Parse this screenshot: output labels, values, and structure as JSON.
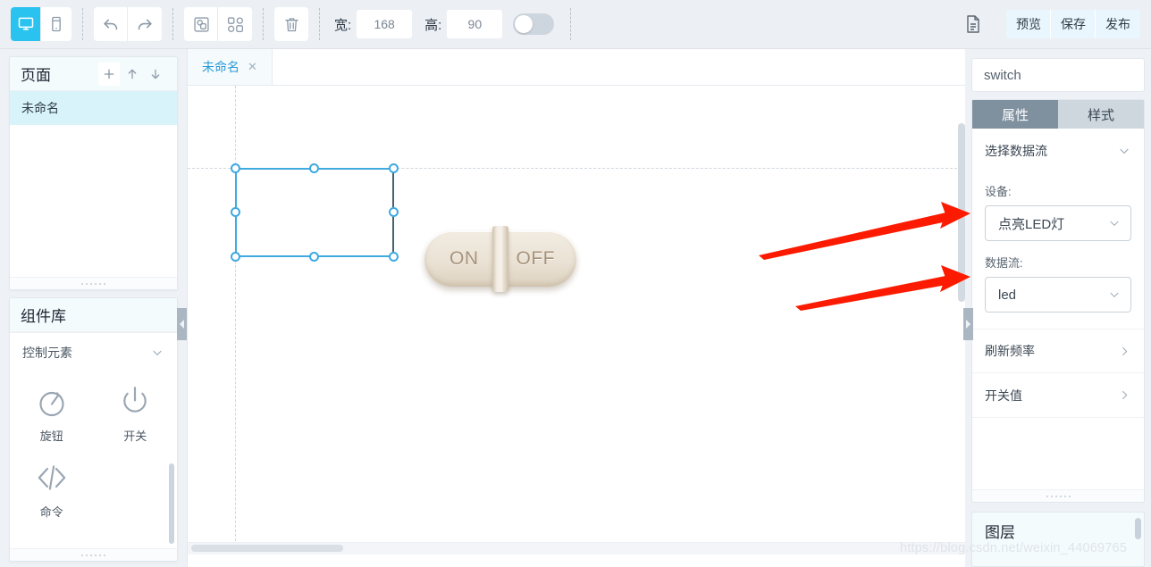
{
  "toolbar": {
    "view_desktop_icon": "desktop-icon",
    "view_mobile_icon": "mobile-icon",
    "undo_icon": "undo-arrow-icon",
    "redo_icon": "redo-arrow-icon",
    "group_icon": "group-icon",
    "ungroup_icon": "ungroup-icon",
    "delete_icon": "trash-icon",
    "width_label": "宽:",
    "width_value": "168",
    "height_label": "高:",
    "height_value": "90",
    "lock_toggle": "off",
    "document_icon": "document-icon",
    "actions": [
      {
        "label": "预览"
      },
      {
        "label": "保存"
      },
      {
        "label": "发布"
      }
    ]
  },
  "pages_panel": {
    "title": "页面",
    "add_icon": "plus-icon",
    "move_up_icon": "arrow-up-icon",
    "move_down_icon": "arrow-down-icon",
    "items": [
      {
        "label": "未命名",
        "selected": true
      }
    ]
  },
  "library_panel": {
    "title": "组件库",
    "sections": [
      {
        "label": "控制元素",
        "chevron_icon": "chevron-down-icon",
        "items": [
          {
            "label": "旋钮",
            "icon": "knob-icon"
          },
          {
            "label": "开关",
            "icon": "power-switch-icon"
          },
          {
            "label": "命令",
            "icon": "code-brackets-icon"
          }
        ]
      }
    ]
  },
  "canvas": {
    "tabs": [
      {
        "label": "未命名",
        "close_icon": "close-icon",
        "active": true
      }
    ],
    "widget": {
      "type": "toggle-switch",
      "on_label": "ON",
      "off_label": "OFF"
    }
  },
  "properties_panel": {
    "name_value": "switch",
    "tabs": [
      {
        "label": "属性",
        "active": true
      },
      {
        "label": "样式",
        "active": false
      }
    ],
    "datastream_row": {
      "label": "选择数据流",
      "chevron_icon": "chevron-down-icon"
    },
    "device_field": {
      "label": "设备:",
      "value": "点亮LED灯",
      "chevron_icon": "chevron-down-icon"
    },
    "datastream_field": {
      "label": "数据流:",
      "value": "led",
      "chevron_icon": "chevron-down-icon"
    },
    "rows": [
      {
        "label": "刷新频率",
        "caret_icon": "chevron-right-icon"
      },
      {
        "label": "开关值",
        "caret_icon": "chevron-right-icon"
      }
    ]
  },
  "layers_panel": {
    "title": "图层"
  },
  "annotations": {
    "arrow_color": "#fc1a00",
    "arrows": [
      {
        "name": "arrow-to-device-select"
      },
      {
        "name": "arrow-to-datastream-select"
      }
    ]
  },
  "watermark": {
    "text": "https://blog.csdn.net/weixin_44069765"
  }
}
